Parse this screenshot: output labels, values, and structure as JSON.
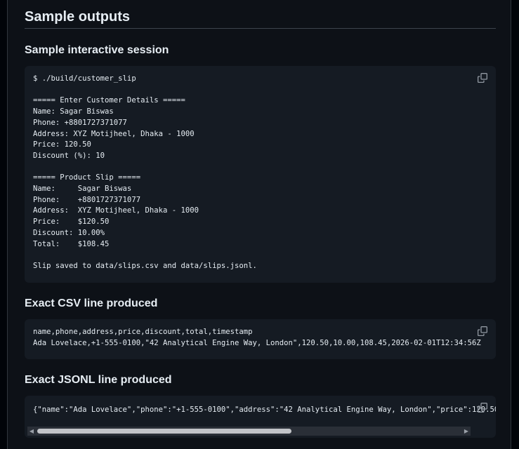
{
  "section_title": "Sample outputs",
  "interactive": {
    "heading": "Sample interactive session",
    "code": "$ ./build/customer_slip\n\n===== Enter Customer Details =====\nName: Sagar Biswas\nPhone: +8801727371077\nAddress: XYZ Motijheel, Dhaka - 1000\nPrice: 120.50\nDiscount (%): 10\n\n===== Product Slip =====\nName:     Sagar Biswas\nPhone:    +8801727371077\nAddress:  XYZ Motijheel, Dhaka - 1000\nPrice:    $120.50\nDiscount: 10.00%\nTotal:    $108.45\n\nSlip saved to data/slips.csv and data/slips.jsonl."
  },
  "csv": {
    "heading": "Exact CSV line produced",
    "code": "name,phone,address,price,discount,total,timestamp\nAda Lovelace,+1-555-0100,\"42 Analytical Engine Way, London\",120.50,10.00,108.45,2026-02-01T12:34:56Z"
  },
  "jsonl": {
    "heading": "Exact JSONL line produced",
    "code": "{\"name\":\"Ada Lovelace\",\"phone\":\"+1-555-0100\",\"address\":\"42 Analytical Engine Way, London\",\"price\":120.50"
  },
  "icons": {
    "copy": "copy-icon",
    "scroll_left": "scroll-left-arrow-icon",
    "scroll_right": "scroll-right-arrow-icon"
  },
  "colors": {
    "page_bg": "#0d1117",
    "code_bg": "#151b23",
    "text": "#e6edf3",
    "icon": "#9198a1"
  }
}
